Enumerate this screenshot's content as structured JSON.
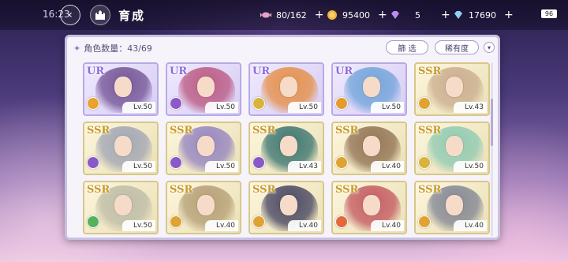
{
  "status_bar": {
    "time": "16:23",
    "battery": "96"
  },
  "header": {
    "title": "育成"
  },
  "resources": [
    {
      "name": "candy",
      "value": "80/162",
      "icon": "candy-icon",
      "color": "#e9a0c8"
    },
    {
      "name": "coin",
      "value": "95400",
      "icon": "coin-icon",
      "color": "#f2b23a"
    },
    {
      "name": "gem_purple",
      "value": "5",
      "icon": "gem-icon",
      "color": "#b98cf0"
    },
    {
      "name": "gem_blue",
      "value": "17690",
      "icon": "diamond-icon",
      "color": "#8fd1f0"
    }
  ],
  "panel": {
    "count_label": "角色数量：43/69",
    "filter_label": "篩 选",
    "sort_label": "稀有度"
  },
  "cards": [
    {
      "rarity": "UR",
      "level": "Lv.50",
      "element_color": "#e8a230",
      "art_color": "#6b4a8e"
    },
    {
      "rarity": "UR",
      "level": "Lv.50",
      "element_color": "#8e58c9",
      "art_color": "#b8507a"
    },
    {
      "rarity": "UR",
      "level": "Lv.50",
      "element_color": "#d9b43a",
      "art_color": "#e58a3c"
    },
    {
      "rarity": "UR",
      "level": "Lv.50",
      "element_color": "#e59a2e",
      "art_color": "#6aa0d8"
    },
    {
      "rarity": "SSR",
      "level": "Lv.43",
      "element_color": "#e0a332",
      "art_color": "#c7a98a"
    },
    {
      "rarity": "SSR",
      "level": "Lv.50",
      "element_color": "#8b58c8",
      "art_color": "#9ba1b2"
    },
    {
      "rarity": "SSR",
      "level": "Lv.50",
      "element_color": "#8b58c8",
      "art_color": "#8e7dc0"
    },
    {
      "rarity": "SSR",
      "level": "Lv.43",
      "element_color": "#8b58c8",
      "art_color": "#2e6c6a"
    },
    {
      "rarity": "SSR",
      "level": "Lv.40",
      "element_color": "#e0a332",
      "art_color": "#8a6a4a"
    },
    {
      "rarity": "SSR",
      "level": "Lv.50",
      "element_color": "#d9b43a",
      "art_color": "#88c8b0"
    },
    {
      "rarity": "SSR",
      "level": "Lv.50",
      "element_color": "#54b25a",
      "art_color": "#b9b9a4"
    },
    {
      "rarity": "SSR",
      "level": "Lv.40",
      "element_color": "#e0a332",
      "art_color": "#b09a70"
    },
    {
      "rarity": "SSR",
      "level": "Lv.40",
      "element_color": "#e0a332",
      "art_color": "#3a3a5a"
    },
    {
      "rarity": "SSR",
      "level": "Lv.40",
      "element_color": "#e26a3a",
      "art_color": "#c0505a"
    },
    {
      "rarity": "SSR",
      "level": "Lv.40",
      "element_color": "#e0a332",
      "art_color": "#7a7f90"
    }
  ]
}
